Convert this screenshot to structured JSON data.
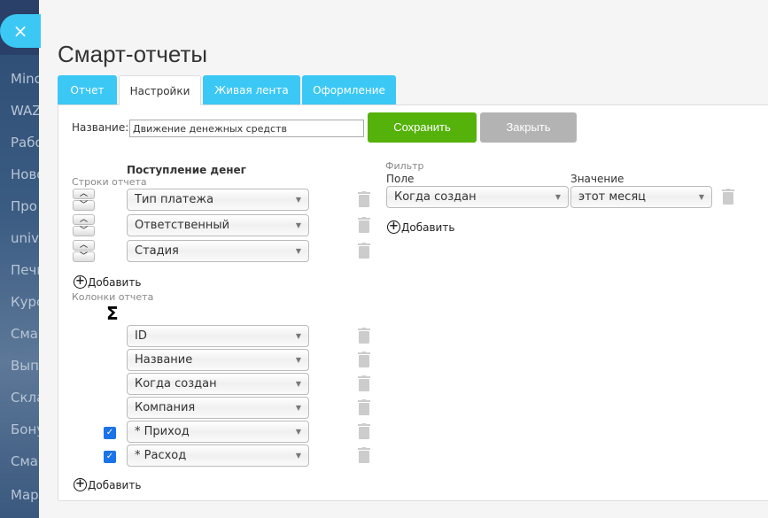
{
  "sidebar": {
    "items": [
      "Minc",
      "WAZ",
      "Рабо",
      "Ново",
      "Про",
      "unive",
      "Печк",
      "Курс",
      "Смар",
      "Выпл",
      "Скла",
      "Бону",
      "Смар",
      "Мар"
    ]
  },
  "close_icon": "×",
  "title": "Смарт-отчеты",
  "tabs": [
    "Отчет",
    "Настройки",
    "Живая лента",
    "Оформление"
  ],
  "active_tab": "Настройки",
  "name_label": "Название:",
  "name_value": "Движение денежных средств",
  "save_label": "Сохранить",
  "close_label": "Закрыть",
  "colors": {
    "accent": "#3bc8f5",
    "save": "#55b20a",
    "close": "#b3b3b3",
    "checkbox": "#1a73e8"
  },
  "group_title": "Поступление денег",
  "rows_label": "Строки отчета",
  "rows": [
    "Тип платежа",
    "Ответственный",
    "Стадия"
  ],
  "add_label": "Добавить",
  "columns_label": "Колонки отчета",
  "sum_symbol": "Σ",
  "columns": [
    {
      "field": "ID",
      "checked": false
    },
    {
      "field": "Название",
      "checked": false
    },
    {
      "field": "Когда создан",
      "checked": false
    },
    {
      "field": "Компания",
      "checked": false
    },
    {
      "field": "* Приход",
      "checked": true
    },
    {
      "field": "* Расход",
      "checked": true
    }
  ],
  "filter": {
    "title": "Фильтр",
    "field_label": "Поле",
    "value_label": "Значение",
    "field": "Когда создан",
    "value": "этот месяц",
    "add_label": "Добавить"
  }
}
